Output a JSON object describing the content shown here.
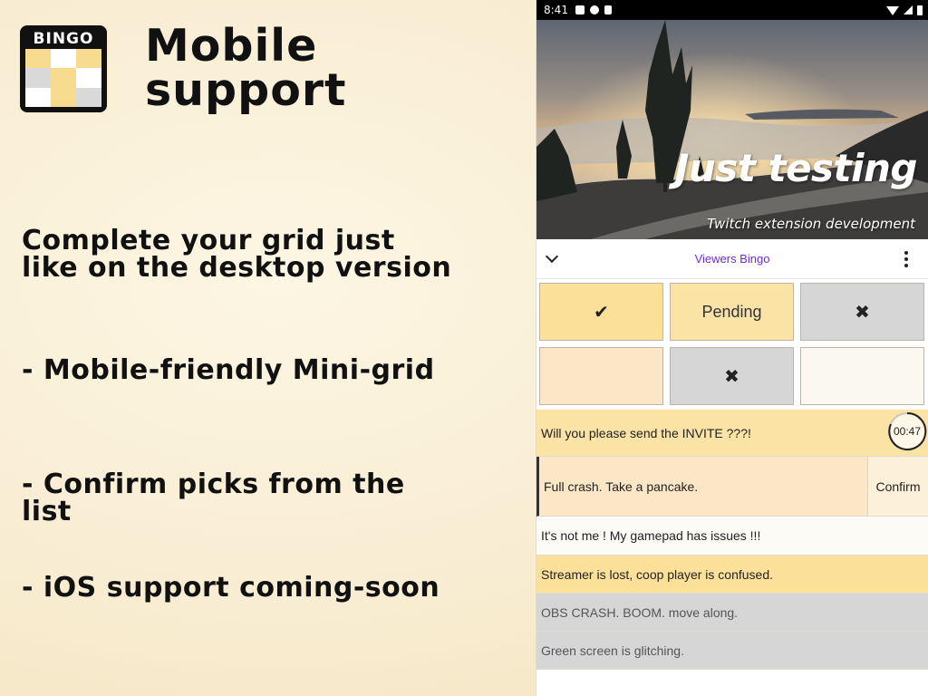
{
  "logo": {
    "label": "BINGO",
    "cells": [
      "#f7dc8f",
      "#ffffff",
      "#f7dc8f",
      "#d9d9d9",
      "#f7dc8f",
      "#ffffff",
      "#ffffff",
      "#f7dc8f",
      "#d9d9d9"
    ]
  },
  "promo": {
    "headline_line1": "Mobile",
    "headline_line2": "support",
    "point1_line1": "Complete your grid just",
    "point1_line2": "like on the desktop version",
    "point2": "- Mobile-friendly Mini-grid",
    "point3_line1": "- Confirm picks from the",
    "point3_line2": "list",
    "point4": "- iOS support coming-soon"
  },
  "phone": {
    "status_time": "8:41",
    "video_title": "Just testing",
    "video_subtitle": "Twitch extension development",
    "extension_title": "Viewers Bingo",
    "grid": [
      {
        "text": "✔",
        "color": "#fbe09a"
      },
      {
        "text": "Pending",
        "color": "#fbe3a6"
      },
      {
        "text": "✖",
        "color": "#d6d6d6"
      },
      {
        "text": "",
        "color": "#fbe7c6"
      },
      {
        "text": "✖",
        "color": "#d6d6d6"
      },
      {
        "text": "",
        "color": "#fbf8f1"
      }
    ],
    "list": [
      {
        "text": "Will you please send the INVITE ???!",
        "color": "#fbe3a6",
        "timer": "00:47"
      },
      {
        "text": "Full crash. Take a pancake.",
        "color": "#fbe7c6",
        "action": "Confirm"
      },
      {
        "text": "It's not me ! My gamepad has issues !!!",
        "color": "#fdfbf6"
      },
      {
        "text": "Streamer is lost, coop player is confused.",
        "color": "#fbe09a"
      },
      {
        "text": "OBS CRASH. BOOM. move along.",
        "color": "#d6d6d6"
      },
      {
        "text": "Green screen is glitching.",
        "color": "#d6d6d6"
      }
    ]
  }
}
